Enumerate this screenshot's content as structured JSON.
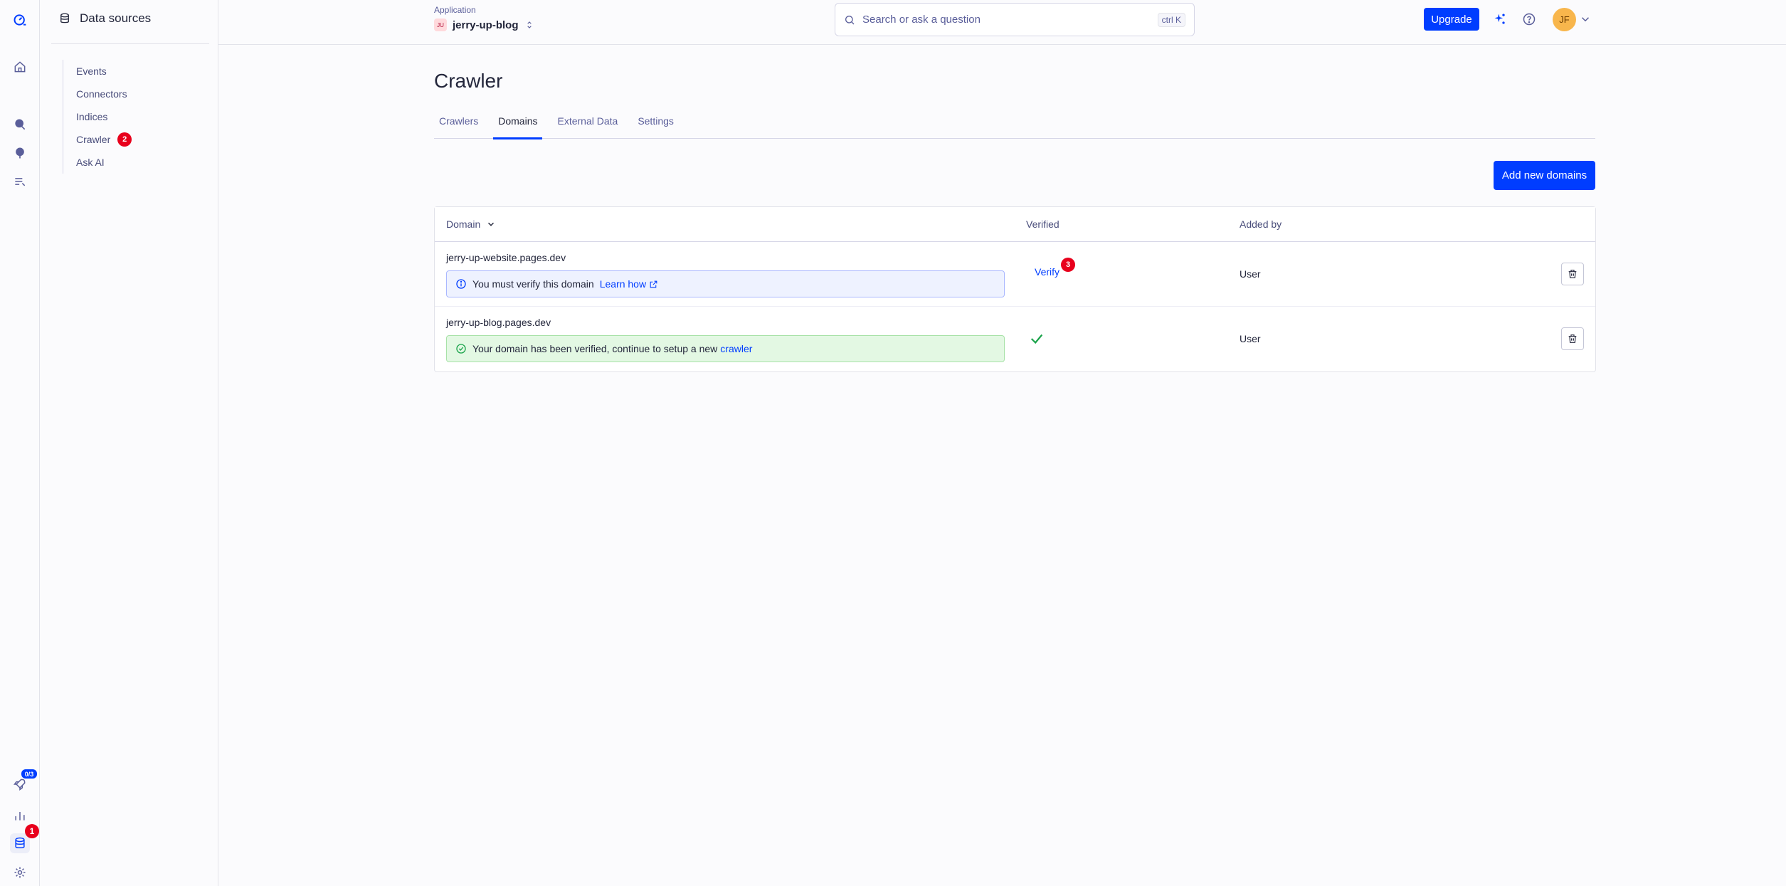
{
  "rail": {
    "rocket_badge": "0/3",
    "database_badge": "1"
  },
  "sidebar": {
    "title": "Data sources",
    "items": [
      {
        "label": "Events"
      },
      {
        "label": "Connectors"
      },
      {
        "label": "Indices"
      },
      {
        "label": "Crawler",
        "badge": "2"
      },
      {
        "label": "Ask AI"
      }
    ]
  },
  "header": {
    "app_label": "Application",
    "app_name": "jerry-up-blog",
    "app_initials": "JU",
    "search_placeholder": "Search or ask a question",
    "search_shortcut": "ctrl K",
    "upgrade_label": "Upgrade",
    "user_initials": "JF"
  },
  "page": {
    "title": "Crawler",
    "tabs": [
      {
        "label": "Crawlers"
      },
      {
        "label": "Domains",
        "active": true
      },
      {
        "label": "External Data"
      },
      {
        "label": "Settings"
      }
    ],
    "add_button": "Add new domains"
  },
  "table": {
    "headers": {
      "domain": "Domain",
      "verified": "Verified",
      "added_by": "Added by"
    },
    "rows": [
      {
        "domain": "jerry-up-website.pages.dev",
        "notice_text": "You must verify this domain",
        "notice_link": "Learn how",
        "verify_label": "Verify",
        "verify_badge": "3",
        "added_by": "User"
      },
      {
        "domain": "jerry-up-blog.pages.dev",
        "notice_text": "Your domain has been verified, continue to setup a new",
        "notice_link": "crawler",
        "added_by": "User"
      }
    ]
  },
  "colors": {
    "accent": "#003dff",
    "badge": "#e8001c",
    "success": "#1aa34a"
  }
}
